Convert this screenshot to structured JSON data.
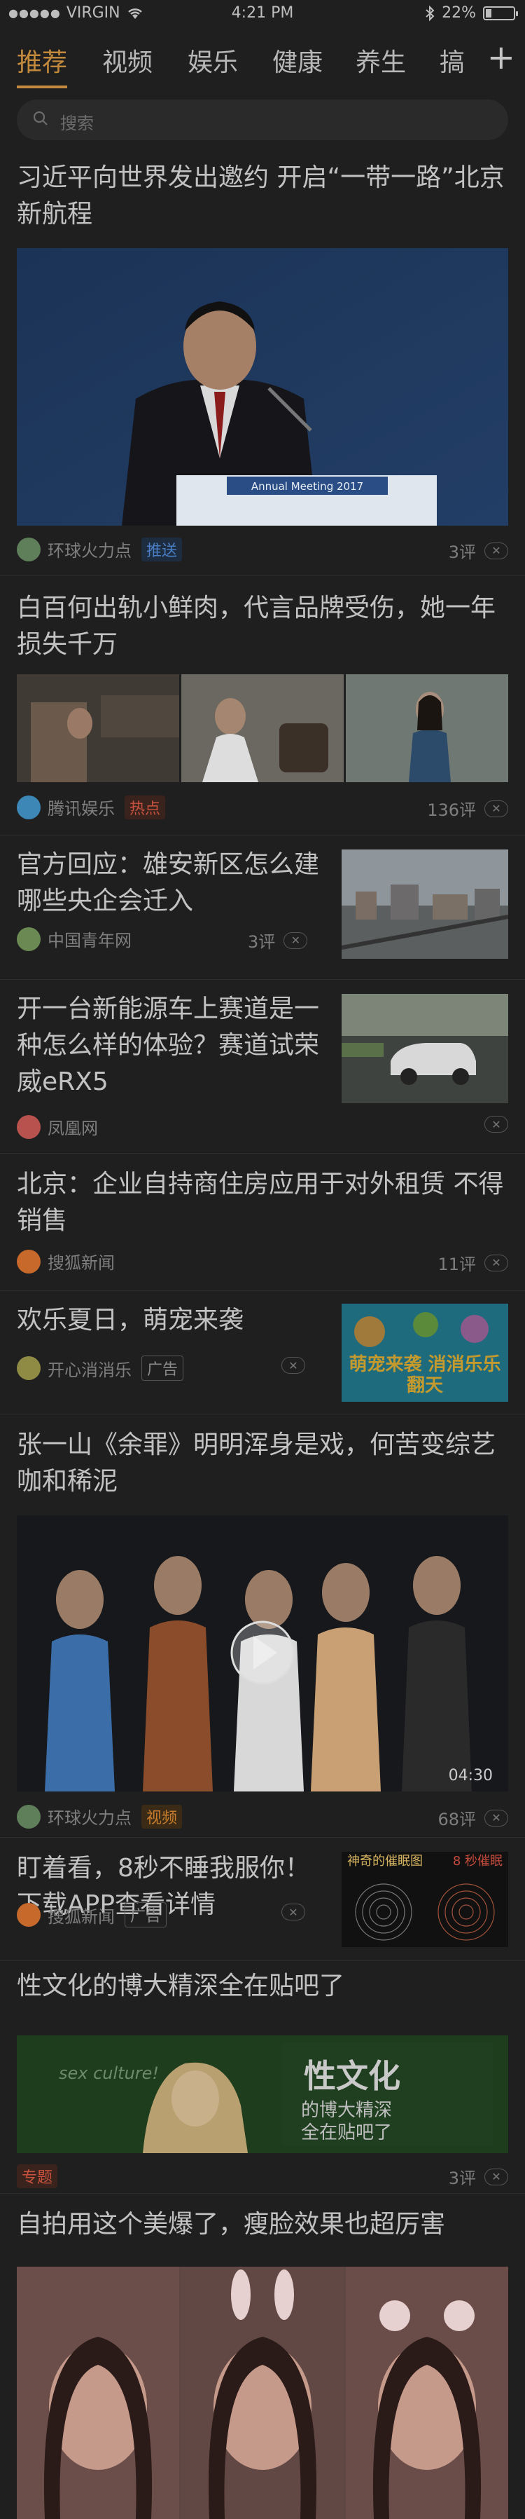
{
  "status_bar": {
    "carrier": "VIRGIN",
    "signal_dots": "●●●●●",
    "time": "4:21 PM",
    "battery_level": 0.22,
    "battery_text": "22%"
  },
  "tabs": [
    "推荐",
    "视频",
    "娱乐",
    "健康",
    "养生",
    "搞"
  ],
  "active_tab": 0,
  "search": {
    "placeholder": "搜索"
  },
  "feed": [
    {
      "title": "习近平向世界发出邀约 开启“一带一路”北京新航程",
      "image_caption": "Annual Meeting 2017",
      "source": "环球火力点",
      "tag": "推送",
      "comments": "3评"
    },
    {
      "title": "白百何出轨小鲜肉，代言品牌受伤，她一年损失千万",
      "source": "腾讯娱乐",
      "tag": "热点",
      "comments": "136评"
    },
    {
      "title": "官方回应：雄安新区怎么建 哪些央企会迁入",
      "source": "中国青年网",
      "comments": "3评"
    },
    {
      "title": "开一台新能源车上赛道是一种怎么样的体验？赛道试荣威eRX5",
      "source": "凤凰网"
    },
    {
      "title": "北京：企业自持商住房应用于对外租赁 不得销售",
      "source": "搜狐新闻",
      "comments": "11评"
    },
    {
      "title": "欢乐夏日，萌宠来袭",
      "source": "开心消消乐",
      "tag": "广告",
      "image_text": "萌宠来袭 消消乐乐翻天"
    },
    {
      "title": "张一山《余罪》明明浑身是戏，何苦变综艺咖和稀泥",
      "source": "环球火力点",
      "tag": "视频",
      "duration": "04:30",
      "comments": "68评"
    },
    {
      "title": "盯着看，8秒不睡我服你！下载APP查看详情",
      "source": "搜狐新闻",
      "tag": "广告",
      "image_text_1": "神奇的催眠图",
      "image_text_2": "8 秒催眠"
    },
    {
      "title": "性文化的博大精深全在贴吧了",
      "tag": "专题",
      "comments": "3评",
      "banner_left": "sex culture!",
      "banner_right": "性文化",
      "banner_sub_1": "的博大精深",
      "banner_sub_2": "全在贴吧了"
    },
    {
      "title": "自拍用这个美爆了，瘦脸效果也超厉害"
    }
  ]
}
